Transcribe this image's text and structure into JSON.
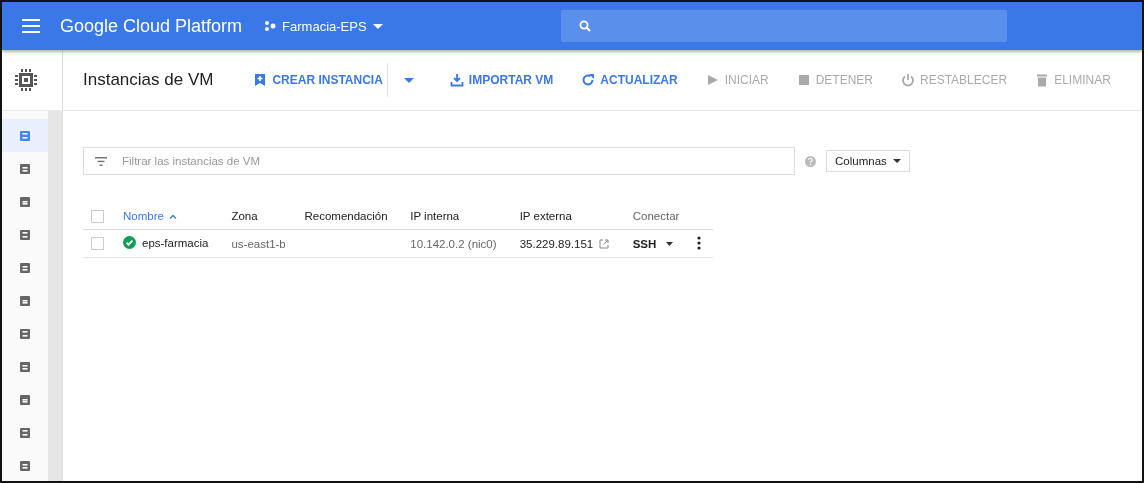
{
  "topbar": {
    "title": "Google Cloud Platform",
    "project": "Farmacia-EPS"
  },
  "page": {
    "title": "Instancias de VM"
  },
  "actions": [
    {
      "label": "CREAR INSTANCIA",
      "kind": "add",
      "disabled": false,
      "menu": true
    },
    {
      "label": "IMPORTAR VM",
      "kind": "import",
      "disabled": false,
      "menu": false
    },
    {
      "label": "ACTUALIZAR",
      "kind": "refresh",
      "disabled": false,
      "menu": false
    },
    {
      "label": "INICIAR",
      "kind": "play",
      "disabled": true,
      "menu": false
    },
    {
      "label": "DETENER",
      "kind": "stop",
      "disabled": true,
      "menu": false
    },
    {
      "label": "RESTABLECER",
      "kind": "power",
      "disabled": true,
      "menu": false
    },
    {
      "label": "ELIMINAR",
      "kind": "trash",
      "disabled": true,
      "menu": false
    }
  ],
  "sidebar": {
    "items": [
      {
        "selected": true
      },
      {
        "selected": false
      },
      {
        "selected": false
      },
      {
        "selected": false
      },
      {
        "selected": false
      },
      {
        "selected": false
      },
      {
        "selected": false
      },
      {
        "selected": false
      },
      {
        "selected": false
      },
      {
        "selected": false
      },
      {
        "selected": false
      }
    ]
  },
  "filter": {
    "placeholder": "Filtrar las instancias de VM"
  },
  "columns_button": "Columnas",
  "table": {
    "all_checked": false,
    "columns": [
      {
        "label": "Nombre",
        "sorted": true
      },
      {
        "label": "Zona",
        "sorted": false
      },
      {
        "label": "Recomendación",
        "sorted": false
      },
      {
        "label": "IP interna",
        "sorted": false
      },
      {
        "label": "IP externa",
        "sorted": false
      },
      {
        "label": "Conectar",
        "sorted": false
      }
    ],
    "rows": [
      {
        "checked": false,
        "kind": "running",
        "name": "eps-farmacia",
        "zone": "us-east1-b",
        "internal_ip": "10.142.0.2 (nic0)",
        "external_ip": "35.229.89.151",
        "connect": "SSH"
      }
    ]
  }
}
